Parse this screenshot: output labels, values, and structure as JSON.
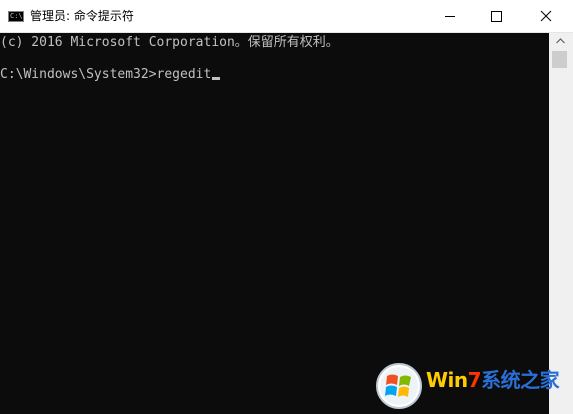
{
  "window": {
    "title": "管理员: 命令提示符",
    "app_icon": "console-icon",
    "controls": {
      "minimize_icon": "minimize-icon",
      "maximize_icon": "maximize-icon",
      "close_icon": "close-icon"
    }
  },
  "console": {
    "lines": [
      "(c) 2016 Microsoft Corporation。保留所有权利。",
      "C:\\Windows\\System32>regedit"
    ],
    "text_color": "#c0c0c0",
    "background_color": "#0c0c0c"
  },
  "watermark": {
    "logo": "windows-flag-logo",
    "text_w": "Wi",
    "text_n": "n",
    "text_7": "7",
    "text_rest": "系统之家"
  }
}
